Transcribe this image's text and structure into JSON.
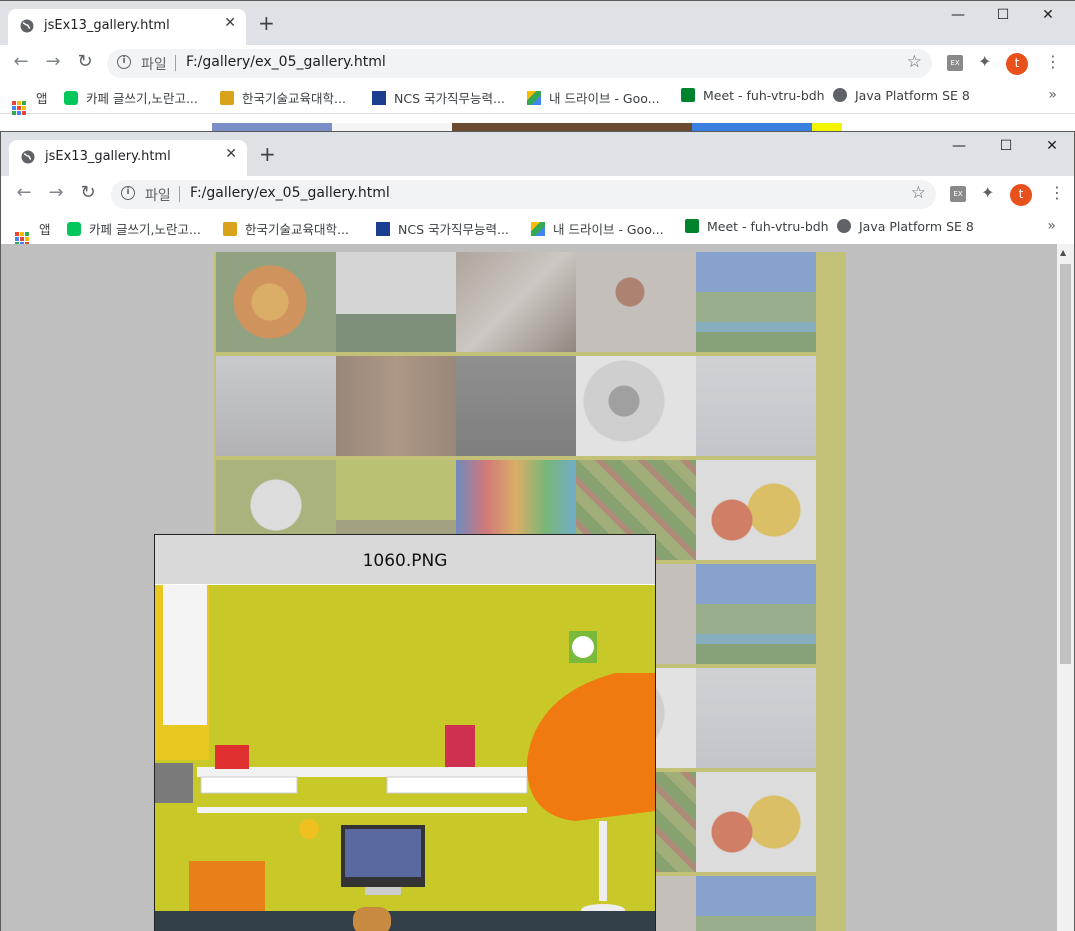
{
  "browser": {
    "tab_title": "jsEx13_gallery.html",
    "new_tab": "+",
    "tab_close": "✕",
    "controls": {
      "minimize": "—",
      "maximize": "☐",
      "close": "✕"
    },
    "nav": {
      "back": "←",
      "forward": "→",
      "reload": "↻"
    },
    "address": {
      "scheme_label": "파일",
      "url": "F:/gallery/ex_05_gallery.html"
    },
    "star": "☆",
    "ext_label": "EX",
    "profile_initial": "t",
    "menu": "⋮",
    "bookmarks": {
      "apps": "앱",
      "items": [
        {
          "label": "카페 글쓰기,노란고...",
          "icon": "cafe-icon",
          "color": "#03c75a"
        },
        {
          "label": "한국기술교육대학...",
          "icon": "university-icon",
          "color": "#d8a21a"
        },
        {
          "label": "NCS 국가직무능력...",
          "icon": "ncs-icon",
          "color": "#1a3d8f"
        },
        {
          "label": "내 드라이브 - Goo...",
          "icon": "drive-icon",
          "color": "#fbbc04"
        },
        {
          "label": "Meet - fuh-vtru-bdh",
          "icon": "meet-icon",
          "color": "#00832d"
        },
        {
          "label": "Java Platform SE 8",
          "icon": "globe-icon",
          "color": "#5f6368"
        }
      ],
      "more": "»"
    }
  },
  "gallery": {
    "rows": [
      [
        "sunflower",
        "leaves-chart",
        "snow-street",
        "ring",
        "mountain-lake"
      ],
      [
        "snow-house",
        "2017-blocks",
        "happy-new-year",
        "flower-bw",
        "snow-field"
      ],
      [
        "white-kitten",
        "yellow-desk",
        "numbers",
        "green-mosaic",
        "larva"
      ],
      [
        "",
        "",
        "",
        "ring",
        "mountain-lake"
      ],
      [
        "",
        "",
        "",
        "flower-bw",
        "snow-field"
      ],
      [
        "",
        "",
        "",
        "green-mosaic",
        "larva"
      ],
      [
        "",
        "",
        "",
        "ring",
        "mountain-lake"
      ]
    ],
    "popup": {
      "title": "1060.PNG"
    }
  }
}
